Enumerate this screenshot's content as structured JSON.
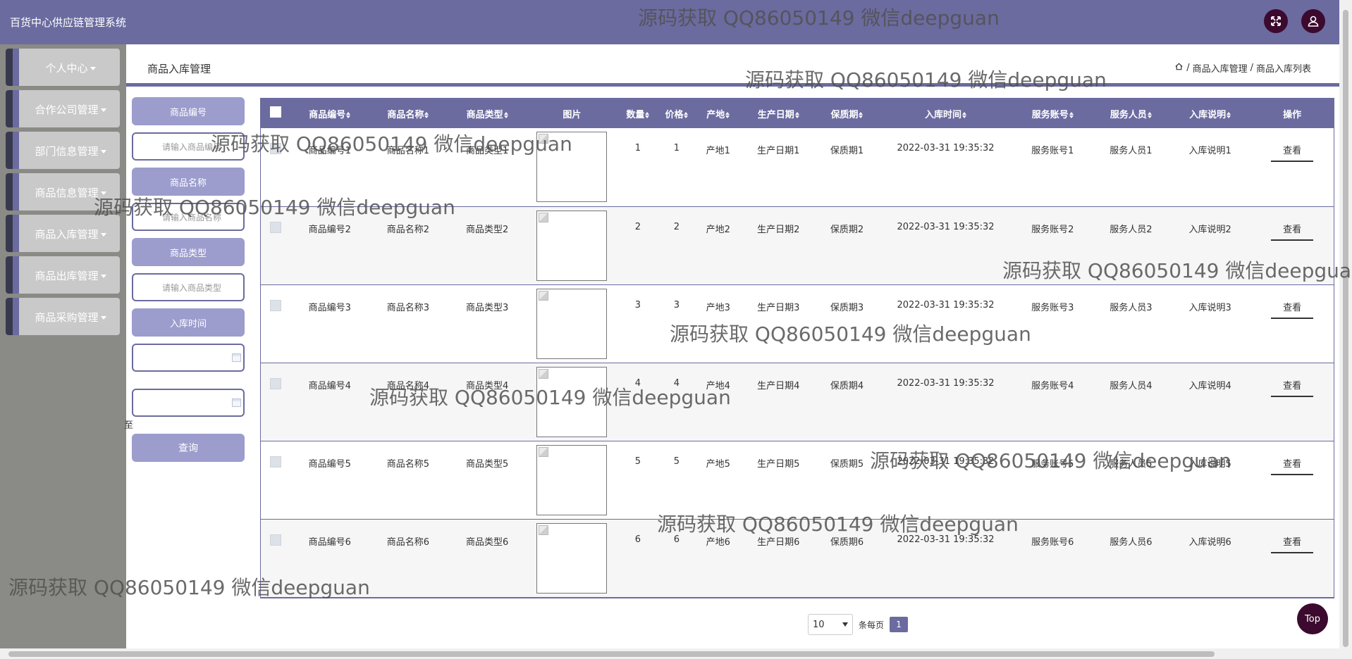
{
  "header": {
    "title": "百货中心供应链管理系统"
  },
  "sidebar": {
    "items": [
      {
        "label": "个人中心"
      },
      {
        "label": "合作公司管理"
      },
      {
        "label": "部门信息管理"
      },
      {
        "label": "商品信息管理"
      },
      {
        "label": "商品入库管理"
      },
      {
        "label": "商品出库管理"
      },
      {
        "label": "商品采购管理"
      }
    ]
  },
  "page": {
    "title": "商品入库管理",
    "breadcrumb": [
      "商品入库管理",
      "商品入库列表"
    ]
  },
  "filter": {
    "code_label": "商品编号",
    "code_placeholder": "请输入商品编号",
    "name_label": "商品名称",
    "name_placeholder": "请输入商品名称",
    "type_label": "商品类型",
    "type_placeholder": "请输入商品类型",
    "time_label": "入库时间",
    "to_label": "至",
    "search_label": "查询"
  },
  "table": {
    "headers": [
      "商品编号",
      "商品名称",
      "商品类型",
      "图片",
      "数量",
      "价格",
      "产地",
      "生产日期",
      "保质期",
      "入库时间",
      "服务账号",
      "服务人员",
      "入库说明",
      "操作"
    ],
    "action_label": "查看",
    "rows": [
      [
        "商品编号1",
        "商品名称1",
        "商品类型1",
        "1",
        "1",
        "产地1",
        "生产日期1",
        "保质期1",
        "2022-03-31 19:35:32",
        "服务账号1",
        "服务人员1",
        "入库说明1"
      ],
      [
        "商品编号2",
        "商品名称2",
        "商品类型2",
        "2",
        "2",
        "产地2",
        "生产日期2",
        "保质期2",
        "2022-03-31 19:35:32",
        "服务账号2",
        "服务人员2",
        "入库说明2"
      ],
      [
        "商品编号3",
        "商品名称3",
        "商品类型3",
        "3",
        "3",
        "产地3",
        "生产日期3",
        "保质期3",
        "2022-03-31 19:35:32",
        "服务账号3",
        "服务人员3",
        "入库说明3"
      ],
      [
        "商品编号4",
        "商品名称4",
        "商品类型4",
        "4",
        "4",
        "产地4",
        "生产日期4",
        "保质期4",
        "2022-03-31 19:35:32",
        "服务账号4",
        "服务人员4",
        "入库说明4"
      ],
      [
        "商品编号5",
        "商品名称5",
        "商品类型5",
        "5",
        "5",
        "产地5",
        "生产日期5",
        "保质期5",
        "2022-03-31 19:35:32",
        "服务账号5",
        "服务人员5",
        "入库说明5"
      ],
      [
        "商品编号6",
        "商品名称6",
        "商品类型6",
        "6",
        "6",
        "产地6",
        "生产日期6",
        "保质期6",
        "2022-03-31 19:35:32",
        "服务账号6",
        "服务人员6",
        "入库说明6"
      ]
    ]
  },
  "pager": {
    "page_size": "10",
    "per_page_label": "条每页",
    "current_page": "1"
  },
  "back_to_top": "Top",
  "watermark": "源码获取 QQ86050149 微信deepguan"
}
